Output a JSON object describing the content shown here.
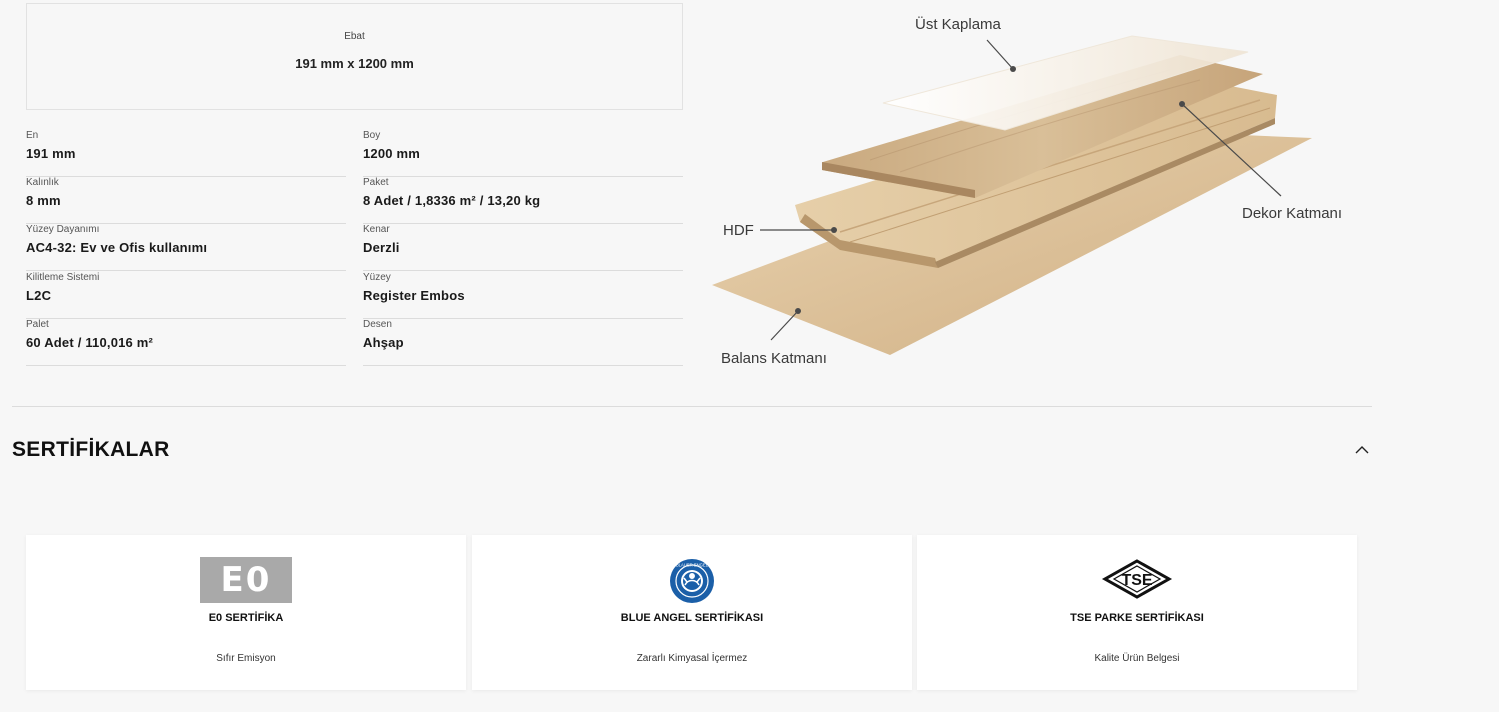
{
  "ebat": {
    "label": "Ebat",
    "value": "191 mm x 1200 mm"
  },
  "specs": {
    "left": [
      {
        "label": "En",
        "value": "191 mm"
      },
      {
        "label": "Kalınlık",
        "value": "8 mm"
      },
      {
        "label": "Yüzey Dayanımı",
        "value": "AC4-32: Ev ve Ofis kullanımı"
      },
      {
        "label": "Kilitleme Sistemi",
        "value": "L2C"
      },
      {
        "label": "Palet",
        "value": "60 Adet / 110,016 m²"
      }
    ],
    "right": [
      {
        "label": "Boy",
        "value": "1200 mm"
      },
      {
        "label": "Paket",
        "value": "8 Adet / 1,8336 m² / 13,20 kg"
      },
      {
        "label": "Kenar",
        "value": "Derzli"
      },
      {
        "label": "Yüzey",
        "value": "Register Embos"
      },
      {
        "label": "Desen",
        "value": "Ahşap"
      }
    ]
  },
  "diagram": {
    "labels": {
      "top": "Üst Kaplama",
      "decor": "Dekor Katmanı",
      "hdf": "HDF",
      "balance": "Balans Katmanı"
    }
  },
  "certificates": {
    "title": "SERTİFİKALAR",
    "toggle_icon": "chevron-up-icon",
    "items": [
      {
        "logo_text": "E0",
        "title": "E0 SERTİFİKA",
        "subtitle": "Sıfır Emisyon",
        "icon": "e0-logo"
      },
      {
        "logo_text": "BLAUER ENGEL",
        "title": "BLUE ANGEL SERTİFİKASI",
        "subtitle": "Zararlı Kimyasal İçermez",
        "icon": "blue-angel-logo"
      },
      {
        "logo_text": "TSE",
        "title": "TSE PARKE SERTİFİKASI",
        "subtitle": "Kalite Ürün Belgesi",
        "icon": "tse-logo"
      }
    ]
  },
  "colors": {
    "background": "#f7f7f7",
    "card": "#ffffff",
    "blue_angel": "#1b5fa8",
    "e0_gray": "#a9a9a9"
  }
}
